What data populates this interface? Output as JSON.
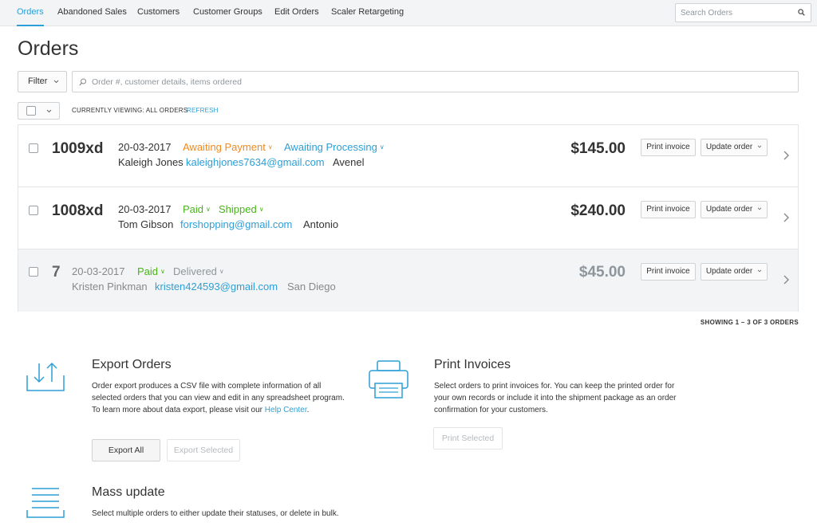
{
  "nav": {
    "tabs": [
      {
        "label": "Orders",
        "active": true
      },
      {
        "label": "Abandoned Sales"
      },
      {
        "label": "Customers"
      },
      {
        "label": "Customer Groups"
      },
      {
        "label": "Edit Orders"
      },
      {
        "label": "Scaler Retargeting"
      }
    ],
    "search_placeholder": "Search Orders"
  },
  "page_title": "Orders",
  "filter": {
    "button_label": "Filter",
    "placeholder": "Order #, customer details, items ordered"
  },
  "list_header": {
    "viewing_label": "CURRENTLY VIEWING: ALL ORDERS",
    "refresh_label": "REFRESH"
  },
  "orders": [
    {
      "number": "1009xd",
      "date": "20-03-2017",
      "payment_status": "Awaiting Payment",
      "fulfillment_status": "Awaiting Processing",
      "customer": "Kaleigh Jones",
      "email": "kaleighjones7634@gmail.com",
      "city": "Avenel",
      "total": "$145.00"
    },
    {
      "number": "1008xd",
      "date": "20-03-2017",
      "payment_status": "Paid",
      "fulfillment_status": "Shipped",
      "customer": "Tom Gibson",
      "email": "forshopping@gmail.com",
      "city": "Antonio",
      "total": "$240.00"
    },
    {
      "number": "7",
      "date": "20-03-2017",
      "payment_status": "Paid",
      "fulfillment_status": "Delivered",
      "customer": "Kristen Pinkman",
      "email": "kristen424593@gmail.com",
      "city": "San Diego",
      "total": "$45.00"
    }
  ],
  "row_actions": {
    "print_invoice_label": "Print invoice",
    "update_order_label": "Update order"
  },
  "showing_label": "SHOWING 1 – 3 OF 3 ORDERS",
  "export": {
    "title": "Export Orders",
    "text": "Order export produces a CSV file with complete information of all selected orders that you can view and edit in any spreadsheet program. To learn more about data export, please visit our ",
    "link_label": "Help Center",
    "text_end": ".",
    "export_all_label": "Export All",
    "export_selected_label": "Export Selected"
  },
  "print": {
    "title": "Print Invoices",
    "text": "Select orders to print invoices for. You can keep the printed order for your own records or include it into the shipment package as an order confirmation for your customers.",
    "print_selected_label": "Print Selected"
  },
  "mass_update": {
    "title": "Mass update",
    "text": "Select multiple orders to either update their statuses, or delete in bulk."
  },
  "colors": {
    "accent": "#2e9fd6",
    "awaiting": "#f18a1e",
    "paid": "#49b41a",
    "muted": "#8e969c"
  }
}
